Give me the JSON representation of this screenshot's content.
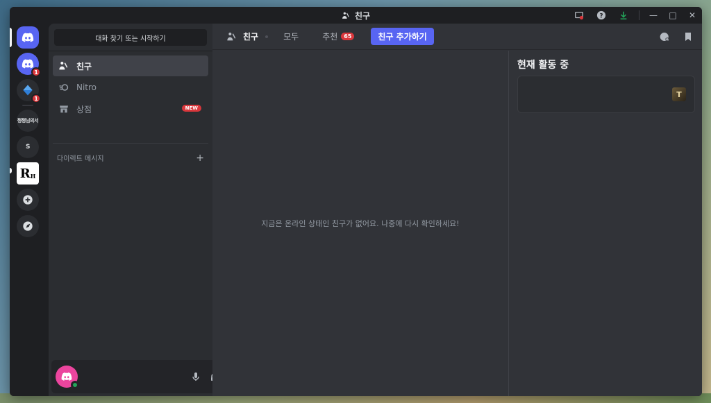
{
  "window": {
    "title": "친구"
  },
  "servers": [
    {
      "name": "home",
      "badge": ""
    },
    {
      "name": "server-1",
      "badge": "1"
    },
    {
      "name": "server-2",
      "badge": "1"
    },
    {
      "name": "server-3",
      "label": "쩡쩡님의서"
    },
    {
      "name": "server-4",
      "label": "S"
    },
    {
      "name": "server-5",
      "label": "R",
      "sub": "H"
    }
  ],
  "sidebar": {
    "search_label": "대화 찾기 또는 시작하기",
    "items": [
      {
        "label": "친구"
      },
      {
        "label": "Nitro"
      },
      {
        "label": "상점",
        "badge": "NEW"
      }
    ],
    "dm_header": "다이렉트 메시지",
    "dm_plus": "+"
  },
  "topbar": {
    "title": "친구",
    "tabs": [
      {
        "label": "모두"
      },
      {
        "label": "추천",
        "count": "65"
      }
    ],
    "add_friend": "친구 추가하기"
  },
  "main": {
    "empty_message": "지금은 온라인 상태인 친구가 없어요. 나중에 다시 확인하세요!"
  },
  "active_now": {
    "title": "현재 활동 중",
    "game_glyph": "T"
  },
  "colors": {
    "blurple": "#5865f2",
    "red": "#da373c",
    "green": "#23a55a",
    "highlight": "#e0131a"
  }
}
